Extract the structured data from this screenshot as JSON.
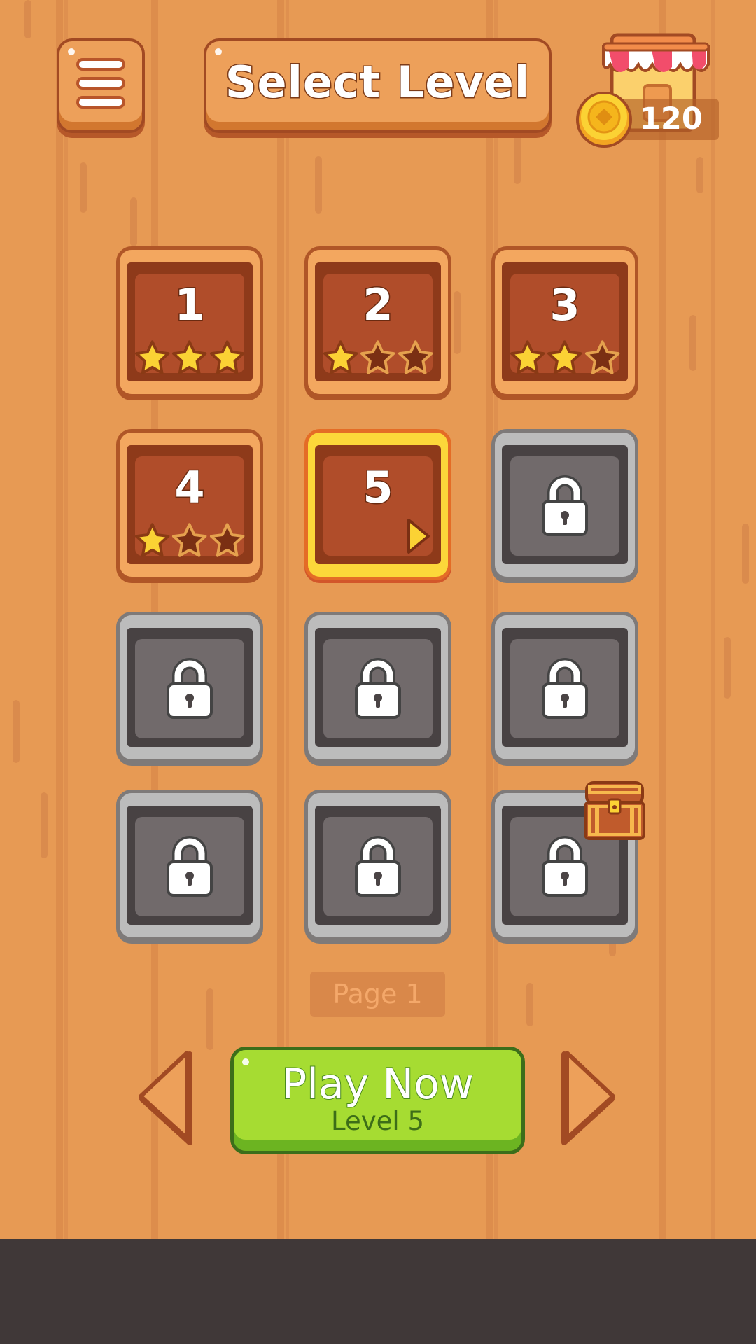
{
  "header": {
    "title": "Select Level",
    "menu_icon": "hamburger-menu-icon",
    "shop_icon": "shop-stall-icon",
    "coins": {
      "icon": "gold-coin-icon",
      "count": "120"
    }
  },
  "levels": [
    {
      "label": "1",
      "state": "unlocked",
      "stars": 3
    },
    {
      "label": "2",
      "state": "unlocked",
      "stars": 1
    },
    {
      "label": "3",
      "state": "unlocked",
      "stars": 2
    },
    {
      "label": "4",
      "state": "unlocked",
      "stars": 1
    },
    {
      "label": "5",
      "state": "current",
      "stars": 0
    },
    {
      "label": "",
      "state": "locked"
    },
    {
      "label": "",
      "state": "locked"
    },
    {
      "label": "",
      "state": "locked"
    },
    {
      "label": "",
      "state": "locked"
    },
    {
      "label": "",
      "state": "locked"
    },
    {
      "label": "",
      "state": "locked"
    },
    {
      "label": "",
      "state": "locked",
      "reward": "treasure-chest-icon"
    }
  ],
  "pagination": {
    "page_label": "Page 1",
    "prev_icon": "arrow-left-icon",
    "next_icon": "arrow-right-icon"
  },
  "play_button": {
    "label": "Play Now",
    "sublabel": "Level 5"
  },
  "colors": {
    "wood": "#e79a54",
    "unlocked_tile": "#b04d2a",
    "locked_tile": "#716a6b",
    "current_highlight": "#fcd73a",
    "star_gold": "#fbd234",
    "play_green": "#a6dc32",
    "footer": "#403838"
  }
}
